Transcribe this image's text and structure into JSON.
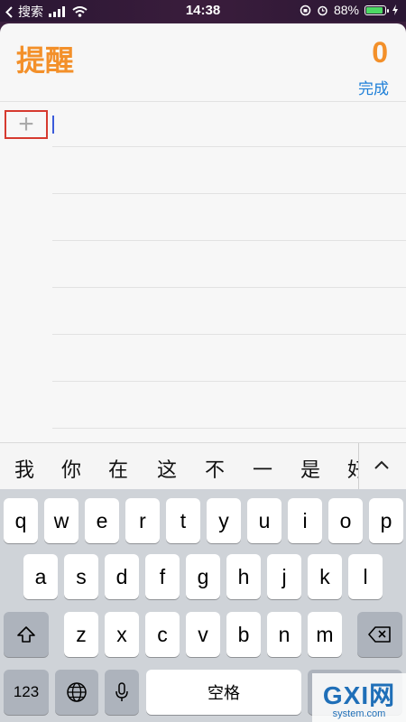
{
  "status_bar": {
    "back_app": "搜索",
    "time": "14:38",
    "battery": "88%",
    "battery_level": 0.88
  },
  "reminders": {
    "title": "提醒",
    "count": "0",
    "done_label": "完成",
    "add_symbol": "+"
  },
  "suggestions": {
    "candidates": [
      "我",
      "你",
      "在",
      "这",
      "不",
      "一",
      "是",
      "好"
    ],
    "expand_symbol": "^"
  },
  "keyboard": {
    "row1": [
      "q",
      "w",
      "e",
      "r",
      "t",
      "y",
      "u",
      "i",
      "o",
      "p"
    ],
    "row2": [
      "a",
      "s",
      "d",
      "f",
      "g",
      "h",
      "j",
      "k",
      "l"
    ],
    "row3": [
      "z",
      "x",
      "c",
      "v",
      "b",
      "n",
      "m"
    ],
    "numbers_key": "123",
    "space_key": "空格"
  },
  "watermark": {
    "logo": "GXI网",
    "site": "system.com"
  },
  "colors": {
    "accent": "#f3902a",
    "link": "#1d7fd8",
    "highlight": "#d63a2f"
  }
}
